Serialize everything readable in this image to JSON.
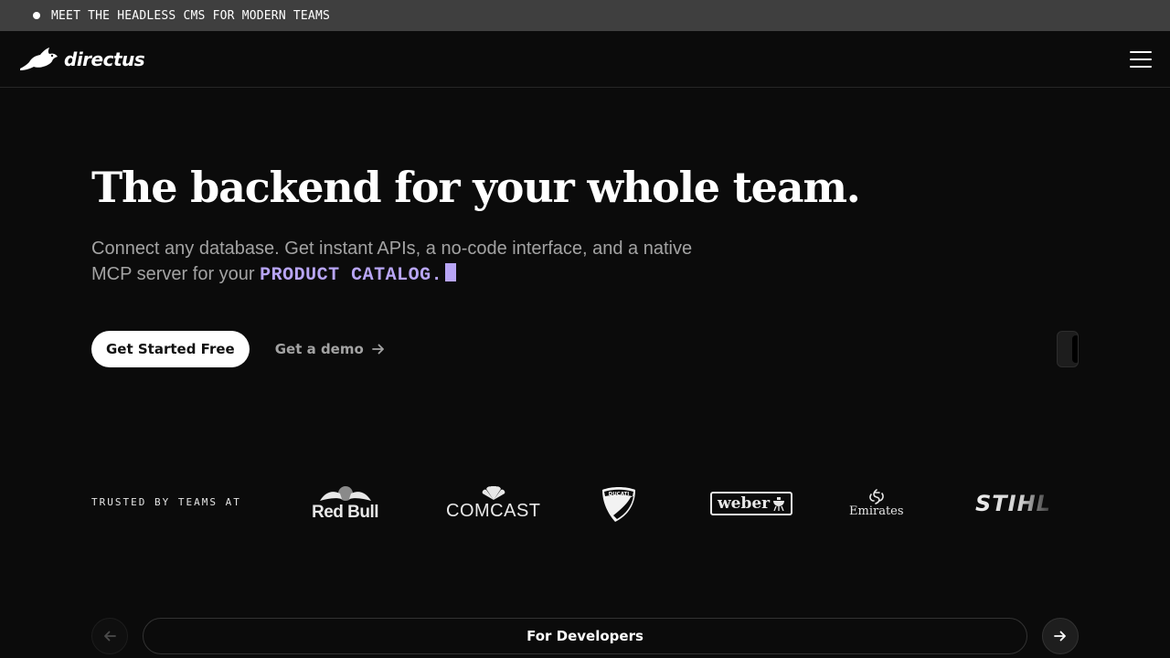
{
  "announcement": {
    "text": "MEET THE HEADLESS CMS FOR MODERN TEAMS"
  },
  "header": {
    "brand": "directus",
    "menu_icon": "hamburger-menu-icon"
  },
  "hero": {
    "title": "The backend for your whole team.",
    "subtitle": "Connect any database. Get instant APIs, a no-code interface, and a native MCP server for your",
    "rotating_word": "PRODUCT CATALOG.",
    "primary_cta": "Get Started Free",
    "secondary_cta": "Get a demo"
  },
  "trusted": {
    "label": "TRUSTED BY TEAMS AT",
    "logos": [
      "Red Bull",
      "COMCAST",
      "DUCATI",
      "weber",
      "Emirates",
      "STIHL"
    ]
  },
  "carousel": {
    "current": "For Developers"
  },
  "colors": {
    "background": "#0b0b0b",
    "accent": "#b8a5f5",
    "announcement_bg": "#3f3f3f"
  }
}
